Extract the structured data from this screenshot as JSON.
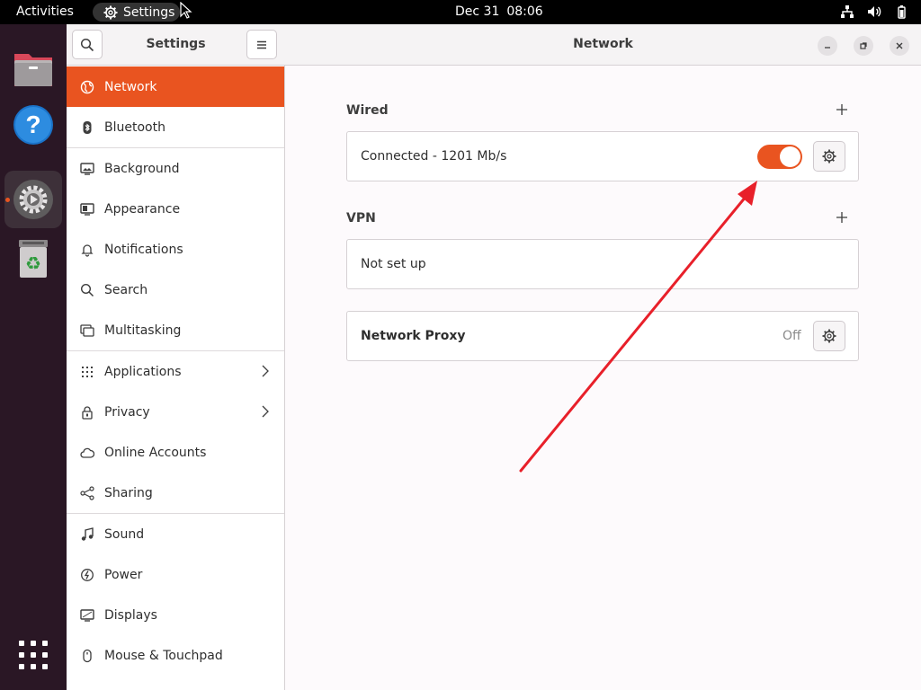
{
  "topbar": {
    "activities": "Activities",
    "app_name": "Settings",
    "date": "Dec 31",
    "time": "08:06",
    "tray_icons": [
      "network-icon",
      "volume-icon",
      "battery-icon"
    ]
  },
  "dock": {
    "items": [
      "files-icon",
      "help-icon",
      "settings-icon",
      "trash-icon"
    ],
    "active": "settings-icon",
    "show_apps": "apps-grid-icon"
  },
  "sidebar": {
    "title": "Settings",
    "items": [
      {
        "label": "Network",
        "icon": "globe-icon",
        "selected": true
      },
      {
        "label": "Bluetooth",
        "icon": "bluetooth-icon"
      },
      {
        "label": "Background",
        "icon": "monitor-icon"
      },
      {
        "label": "Appearance",
        "icon": "appearance-icon"
      },
      {
        "label": "Notifications",
        "icon": "bell-icon"
      },
      {
        "label": "Search",
        "icon": "search-icon"
      },
      {
        "label": "Multitasking",
        "icon": "multitasking-icon"
      },
      {
        "label": "Applications",
        "icon": "apps-icon",
        "has_submenu": true
      },
      {
        "label": "Privacy",
        "icon": "lock-icon",
        "has_submenu": true
      },
      {
        "label": "Online Accounts",
        "icon": "cloud-icon"
      },
      {
        "label": "Sharing",
        "icon": "share-icon"
      },
      {
        "label": "Sound",
        "icon": "music-note-icon"
      },
      {
        "label": "Power",
        "icon": "power-icon"
      },
      {
        "label": "Displays",
        "icon": "display-icon"
      },
      {
        "label": "Mouse & Touchpad",
        "icon": "mouse-icon"
      }
    ]
  },
  "content": {
    "title": "Network",
    "wired": {
      "heading": "Wired",
      "status": "Connected - 1201 Mb/s",
      "enabled": true
    },
    "vpn": {
      "heading": "VPN",
      "status": "Not set up"
    },
    "proxy": {
      "label": "Network Proxy",
      "state": "Off"
    }
  },
  "colors": {
    "accent": "#e95420",
    "annotation_arrow": "#e8202a"
  }
}
